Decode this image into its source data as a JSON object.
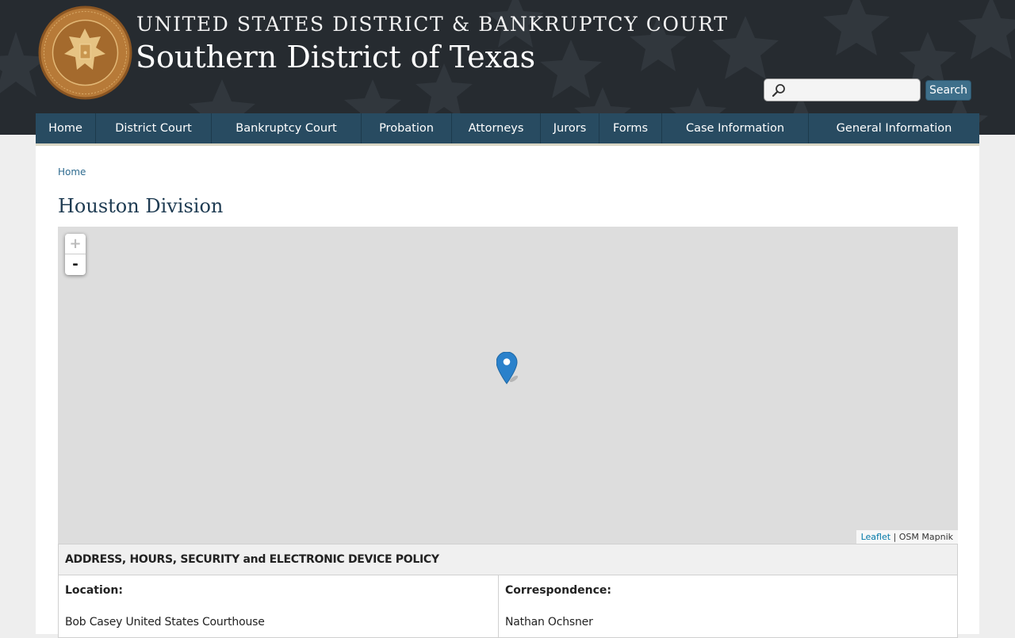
{
  "header": {
    "court_line1": "UNITED STATES DISTRICT & BANKRUPTCY COURT",
    "court_line2": "Southern District of Texas",
    "seal_icon": "court-seal-icon",
    "search": {
      "placeholder": "",
      "value": "",
      "button_label": "Search",
      "icon": "search-icon"
    }
  },
  "nav": {
    "items": [
      {
        "label": "Home"
      },
      {
        "label": "District Court"
      },
      {
        "label": "Bankruptcy Court"
      },
      {
        "label": "Probation"
      },
      {
        "label": "Attorneys"
      },
      {
        "label": "Jurors"
      },
      {
        "label": "Forms"
      },
      {
        "label": "Case Information"
      },
      {
        "label": "General Information"
      }
    ]
  },
  "breadcrumb": {
    "home": "Home"
  },
  "page": {
    "title": "Houston Division"
  },
  "map": {
    "zoom_in": "+",
    "zoom_out": "-",
    "marker_icon": "map-marker-icon",
    "attribution_link": "Leaflet",
    "attribution_separator": "|",
    "attribution_source": "OSM Mapnik"
  },
  "info": {
    "heading": "ADDRESS, HOURS, SECURITY and ELECTRONIC DEVICE POLICY",
    "location_label": "Location:",
    "location_value": "Bob Casey United States Courthouse",
    "correspondence_label": "Correspondence:",
    "correspondence_value": "Nathan Ochsner"
  },
  "colors": {
    "header_bg": "#262b30",
    "nav_bg": "#284b61",
    "title": "#1e3b52",
    "link": "#2e6b8f",
    "map_bg": "#dddddd",
    "marker": "#2a81cb",
    "seal": "#a36a2c"
  }
}
